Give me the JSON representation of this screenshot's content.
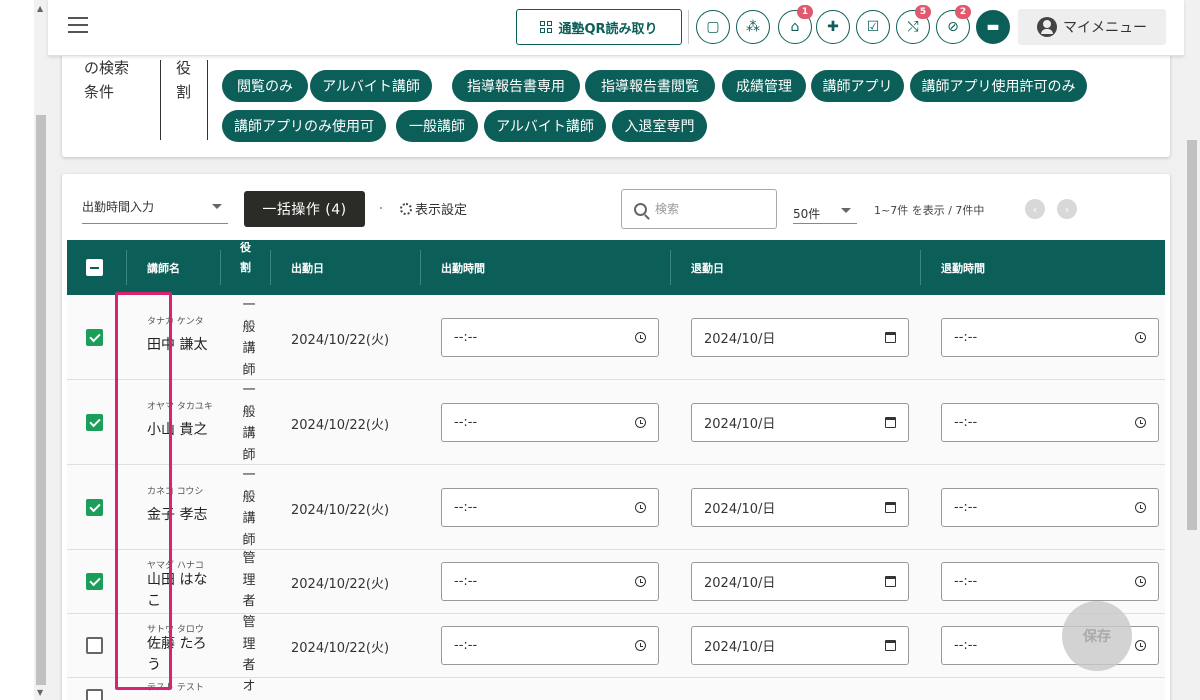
{
  "header": {
    "qr_button": "通塾QR読み取り",
    "icons": [
      {
        "name": "chat-outline-icon",
        "glyph": "▢",
        "badge": ""
      },
      {
        "name": "group-icon",
        "glyph": "⁂",
        "badge": ""
      },
      {
        "name": "school-icon",
        "glyph": "⌂",
        "badge": "1"
      },
      {
        "name": "gift-icon",
        "glyph": "✚",
        "badge": ""
      },
      {
        "name": "checklist-icon",
        "glyph": "☑",
        "badge": ""
      },
      {
        "name": "merge-arrows-icon",
        "glyph": "⤭",
        "badge": "5"
      },
      {
        "name": "block-icon",
        "glyph": "⊘",
        "badge": "2"
      },
      {
        "name": "chat-filled-icon",
        "glyph": "▬",
        "badge": ""
      }
    ],
    "my_menu": "マイメニュー",
    "accent_color": "#0c5e59",
    "badge_color": "#e0596e"
  },
  "filter": {
    "label": "の検索条件",
    "role_label": "役割",
    "chips": [
      "閲覧のみ",
      "アルバイト講師",
      "指導報告書専用",
      "指導報告書閲覧",
      "成績管理",
      "講師アプリ",
      "講師アプリ使用許可のみ",
      "講師アプリのみ使用可",
      "一般講師",
      "アルバイト講師",
      "入退室専門"
    ]
  },
  "toolbar": {
    "select_value": "出勤時間入力",
    "bulk_button": "一括操作 (4)",
    "display_settings": "表示設定",
    "search_placeholder": "検索",
    "per_page": "50件",
    "range": "1~7件 を表示 / 7件中"
  },
  "table": {
    "headers": {
      "name": "講師名",
      "role": "役割",
      "start_date": "出勤日",
      "start_time": "出勤時間",
      "end_date": "退勤日",
      "end_time": "退勤時間"
    },
    "rows": [
      {
        "checked": true,
        "kana": "タナカ ケンタ",
        "name": "田中 謙太",
        "role": "一般講師",
        "date": "2024/10/22(火)",
        "start_time": "--:--",
        "end_date": "2024/10/日",
        "end_time": "--:--"
      },
      {
        "checked": true,
        "kana": "オヤマ タカユキ",
        "name": "小山 貴之",
        "role": "一般講師",
        "date": "2024/10/22(火)",
        "start_time": "--:--",
        "end_date": "2024/10/日",
        "end_time": "--:--"
      },
      {
        "checked": true,
        "kana": "カネコ コウシ",
        "name": "金子 孝志",
        "role": "一般講師",
        "date": "2024/10/22(火)",
        "start_time": "--:--",
        "end_date": "2024/10/日",
        "end_time": "--:--"
      },
      {
        "checked": true,
        "kana": "ヤマダ ハナコ",
        "name": "山田 はなこ",
        "role": "管理者",
        "date": "2024/10/22(火)",
        "start_time": "--:--",
        "end_date": "2024/10/日",
        "end_time": "--:--"
      },
      {
        "checked": false,
        "kana": "サトウ タロウ",
        "name": "佐藤 たろう",
        "role": "管理者",
        "date": "2024/10/22(火)",
        "start_time": "--:--",
        "end_date": "2024/10/日",
        "end_time": "--:--"
      },
      {
        "checked": false,
        "kana": "テスト テスト",
        "name": "",
        "role": "オ",
        "date": "",
        "start_time": "",
        "end_date": "",
        "end_time": ""
      }
    ]
  },
  "save_button": "保存"
}
